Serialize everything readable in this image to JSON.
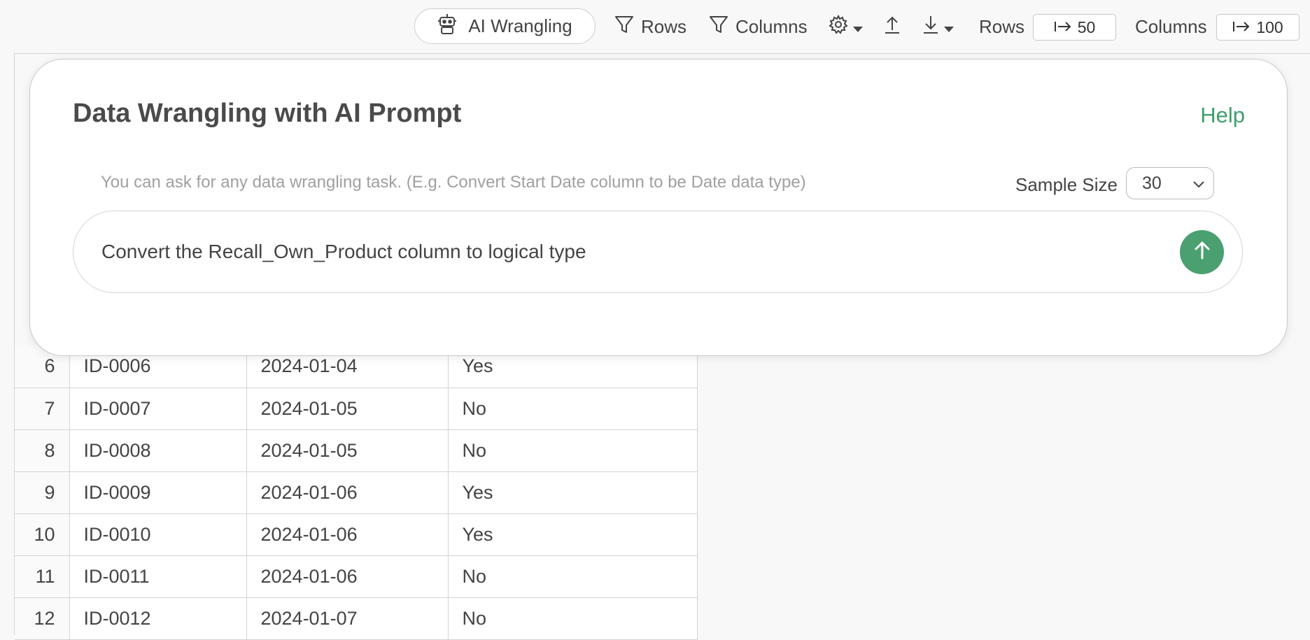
{
  "toolbar": {
    "ai_button_label": "AI Wrangling",
    "rows_filter_label": "Rows",
    "columns_filter_label": "Columns",
    "rows_label": "Rows",
    "rows_value": "50",
    "columns_label": "Columns",
    "columns_value": "100"
  },
  "table": {
    "rows": [
      {
        "n": "6",
        "id": "ID-0006",
        "date": "2024-01-04",
        "val": "Yes"
      },
      {
        "n": "7",
        "id": "ID-0007",
        "date": "2024-01-05",
        "val": "No"
      },
      {
        "n": "8",
        "id": "ID-0008",
        "date": "2024-01-05",
        "val": "No"
      },
      {
        "n": "9",
        "id": "ID-0009",
        "date": "2024-01-06",
        "val": "Yes"
      },
      {
        "n": "10",
        "id": "ID-0010",
        "date": "2024-01-06",
        "val": "Yes"
      },
      {
        "n": "11",
        "id": "ID-0011",
        "date": "2024-01-06",
        "val": "No"
      },
      {
        "n": "12",
        "id": "ID-0012",
        "date": "2024-01-07",
        "val": "No"
      }
    ]
  },
  "modal": {
    "title": "Data Wrangling with AI Prompt",
    "help": "Help",
    "hint": "You can ask for any data wrangling task. (E.g. Convert Start Date column to be Date data type)",
    "sample_label": "Sample Size",
    "sample_value": "30",
    "prompt": "Convert the Recall_Own_Product column to logical type"
  },
  "colors": {
    "accent": "#3e9e6b",
    "send_button": "#4aa070"
  }
}
